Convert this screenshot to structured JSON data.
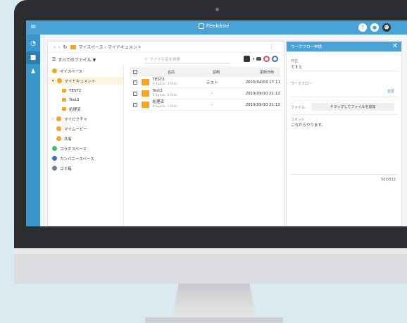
{
  "app": {
    "brand": "Fleekdrive"
  },
  "topbar": {
    "help_icon": "?",
    "notify_icon": "●",
    "user_icon": "☻"
  },
  "breadcrumb": {
    "back": "‹",
    "forward": "›",
    "refresh": "↻",
    "path": "マイスペース › マイドキュメント",
    "more": "⋮"
  },
  "toolbar": {
    "filter_label": "すべてのファイル ▼",
    "search_placeholder": "ファイル名を検索"
  },
  "tree": {
    "items": [
      {
        "label": "マイスペース"
      },
      {
        "label": "マイドキュメント"
      },
      {
        "label": "TEST2"
      },
      {
        "label": "Test3"
      },
      {
        "label": "処理済"
      },
      {
        "label": "マイピクチャ"
      },
      {
        "label": "マイムービー"
      },
      {
        "label": "共有"
      },
      {
        "label": "コラボスペース"
      },
      {
        "label": "カンパニースペース"
      },
      {
        "label": "ゴミ箱"
      }
    ]
  },
  "table": {
    "headers": {
      "name": "名前",
      "desc": "説明",
      "date": "更新日時"
    },
    "rows": [
      {
        "name": "TEST2",
        "sub": "0 Space, 3 Files",
        "desc": "テスト",
        "date": "2020/04/03 17:11"
      },
      {
        "name": "Test3",
        "sub": "0 Space, 0 Files",
        "desc": "-",
        "date": "2019/09/10 21:12"
      },
      {
        "name": "処理済",
        "sub": "0 Space, 1 Files",
        "desc": "-",
        "date": "2019/09/10 21:12"
      }
    ]
  },
  "panel": {
    "title": "ワークフロー申請",
    "close": "✕",
    "subject_label": "件名",
    "subject_value": "てすと",
    "workflow_label": "ワークフロー",
    "change_label": "変更",
    "file_label": "ファイル",
    "drop_label": "ドラッグしてファイルを追加",
    "comment_label": "コメント",
    "comment_value": "これからやります。",
    "counter": "503/512"
  }
}
